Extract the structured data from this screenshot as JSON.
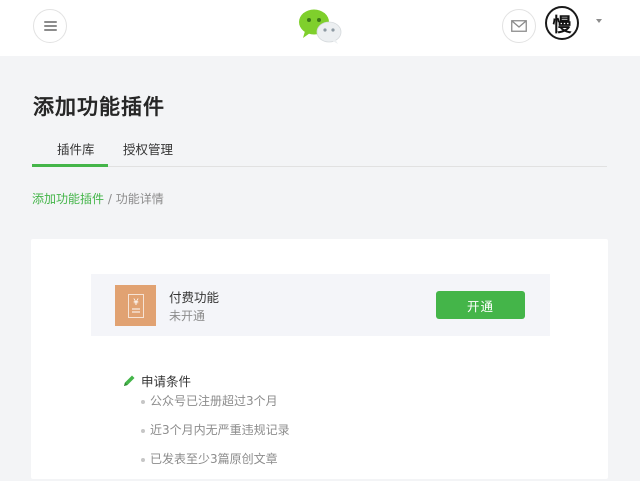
{
  "header": {
    "avatar_char": "慢"
  },
  "page": {
    "title": "添加功能插件"
  },
  "tabs": [
    {
      "label": "插件库",
      "active": true
    },
    {
      "label": "授权管理",
      "active": false
    }
  ],
  "breadcrumb": {
    "parent": "添加功能插件",
    "separator": " / ",
    "current": "功能详情"
  },
  "feature": {
    "icon_char": "¥",
    "name": "付费功能",
    "status": "未开通",
    "action_label": "开通"
  },
  "conditions": {
    "title": "申请条件",
    "items": [
      "公众号已注册超过3个月",
      "近3个月内无严重违规记录",
      "已发表至少3篇原创文章"
    ]
  },
  "colors": {
    "accent": "#44b549",
    "feature_icon_bg": "#e1a272",
    "page_bg": "#f3f4f6"
  }
}
